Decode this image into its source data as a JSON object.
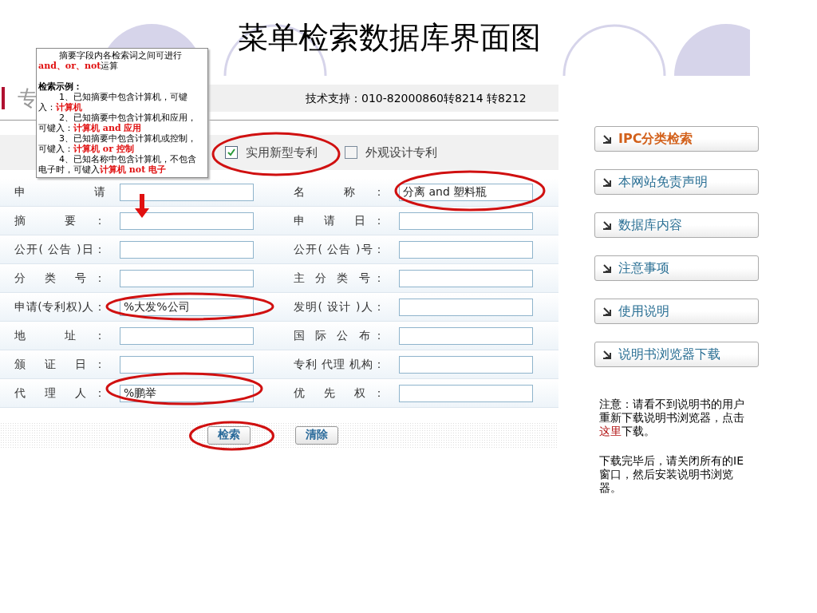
{
  "slide": {
    "title": "菜单检索数据库界面图"
  },
  "header": {
    "title": "专",
    "support": "技术支持：010-82000860转8214 转8212"
  },
  "patent_types": [
    {
      "label": "实用新型专利",
      "checked": true
    },
    {
      "label": "外观设计专利",
      "checked": false
    }
  ],
  "rows": [
    [
      {
        "label": "申请"
      },
      {
        "label": "名 称：",
        "value": "分离 and 塑料瓶"
      }
    ],
    [
      {
        "label": "摘 要："
      },
      {
        "label": "申 请 日："
      }
    ],
    [
      {
        "label": "公开( 公告 )日："
      },
      {
        "label": "公开( 公告 )号："
      }
    ],
    [
      {
        "label": "分 类 号："
      },
      {
        "label": "主 分 类 号："
      }
    ],
    [
      {
        "label": "申请(专利权)人：",
        "value": "%大发%公司"
      },
      {
        "label": "发明( 设计 )人："
      }
    ],
    [
      {
        "label": "地 址："
      },
      {
        "label": "国 际 公 布："
      }
    ],
    [
      {
        "label": "颁 证 日："
      },
      {
        "label": "专利 代理 机构："
      }
    ],
    [
      {
        "label": "代 理 人：",
        "value": "%鹏举"
      },
      {
        "label": "优 先 权："
      }
    ]
  ],
  "buttons": [
    "检索",
    "清除"
  ],
  "side_links": [
    {
      "label": "IPC分类检索",
      "selected": true
    },
    {
      "label": "本网站免责声明",
      "selected": false
    },
    {
      "label": "数据库内容",
      "selected": false
    },
    {
      "label": "注意事项",
      "selected": false
    },
    {
      "label": "使用说明",
      "selected": false
    },
    {
      "label": "说明书浏览器下载",
      "selected": false
    }
  ],
  "notes": [
    {
      "before": "注意：请看不到说明书的用户重新下载说明书浏览器，点击",
      "link": "这里",
      "after": "下载。"
    },
    {
      "before": "下载完毕后，请关闭所有的IE窗口，然后安装说明书浏览器。"
    }
  ],
  "tooltip": {
    "intro": "摘要字段内各检索词之间可进行**and、or、not**运算",
    "heading": "检索示例：",
    "items": [
      "1、已知摘要中包含计算机，可键入：**计算机**",
      "2、已知摘要中包含计算机和应用，可键入：**计算机 and 应用**",
      "3、已知摘要中包含计算机或控制，可键入：**计算机 or 控制**",
      "4、已知名称中包含计算机，不包含电子时，可键入**计算机 not 电子**"
    ]
  }
}
